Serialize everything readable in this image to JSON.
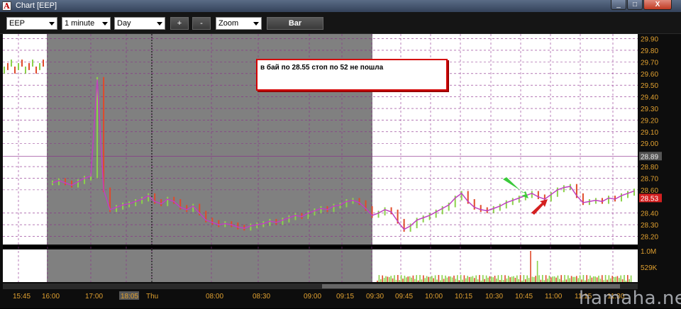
{
  "window": {
    "title": "Chart [EEP]",
    "app_icon": "A",
    "minimize_glyph": "_",
    "maximize_glyph": "□",
    "close_glyph": "X"
  },
  "toolbar": {
    "symbol": "EEP",
    "interval": "1 minute",
    "period": "Day",
    "zoom_in": "+",
    "zoom_out": "-",
    "zoom": "Zoom",
    "bar_button": "Bar"
  },
  "annotation": {
    "text": "в бай по 28.55 стоп по 52 не пошла"
  },
  "watermark": "hamaha.net",
  "colors": {
    "background": "#ffffff",
    "shaded_session": "#808080",
    "grid": "#8a2a8a",
    "tick_labels": "#e0a030",
    "up_bar": "#8cd24a",
    "down_bar": "#e04a2a",
    "ma_line": "#c040c0",
    "price_marker": "#d42020",
    "arrow_green": "#3ac93a",
    "arrow_red": "#d42020"
  },
  "chart_data": {
    "type": "line",
    "title": "",
    "price_axis": {
      "ticks": [
        "29.90",
        "29.80",
        "29.70",
        "29.60",
        "29.50",
        "29.40",
        "29.30",
        "29.20",
        "29.10",
        "29.00",
        "28.89",
        "28.80",
        "28.70",
        "28.60",
        "28.53",
        "28.40",
        "28.30",
        "28.20"
      ],
      "ylim": [
        28.13,
        29.94
      ],
      "highlight_levels": [
        "28.89"
      ],
      "last_price": "28.53"
    },
    "volume_axis": {
      "ticks": [
        "1.0M",
        "529K"
      ]
    },
    "time_axis": {
      "labels": [
        "15:45",
        "16:00",
        "17:00",
        "18:05",
        "Thu",
        "08:00",
        "08:30",
        "09:00",
        "09:15",
        "09:30",
        "09:45",
        "10:00",
        "10:15",
        "10:30",
        "10:45",
        "11:00",
        "11:15",
        "11:30"
      ],
      "highlighted_label": "18:05"
    },
    "series": [
      {
        "values": [
          28.66,
          28.68,
          28.66,
          28.64,
          28.67,
          28.7,
          28.72,
          29.55,
          28.6,
          28.43,
          28.45,
          28.47,
          28.48,
          28.5,
          28.52,
          28.55,
          28.5,
          28.48,
          28.52,
          28.5,
          28.45,
          28.43,
          28.46,
          28.4,
          28.34,
          28.32,
          28.3,
          28.31,
          28.3,
          28.28,
          28.27,
          28.29,
          28.3,
          28.31,
          28.33,
          28.32,
          28.34,
          28.36,
          28.38,
          28.37,
          28.4,
          28.42,
          28.44,
          28.43,
          28.46,
          28.47,
          28.5,
          28.51,
          28.49,
          28.44,
          28.38,
          28.4,
          28.43,
          28.41,
          28.33,
          28.26,
          28.29,
          28.34,
          28.36,
          28.38,
          28.41,
          28.44,
          28.47,
          28.53,
          28.57,
          28.5,
          28.45,
          28.43,
          28.42,
          28.44,
          28.46,
          28.49,
          28.51,
          28.53,
          28.55,
          28.57,
          28.54,
          28.52,
          28.56,
          28.6,
          28.62,
          28.63,
          28.55,
          28.49,
          28.5,
          28.51,
          28.5,
          28.53,
          28.52,
          28.55,
          28.57,
          28.59
        ]
      }
    ]
  }
}
